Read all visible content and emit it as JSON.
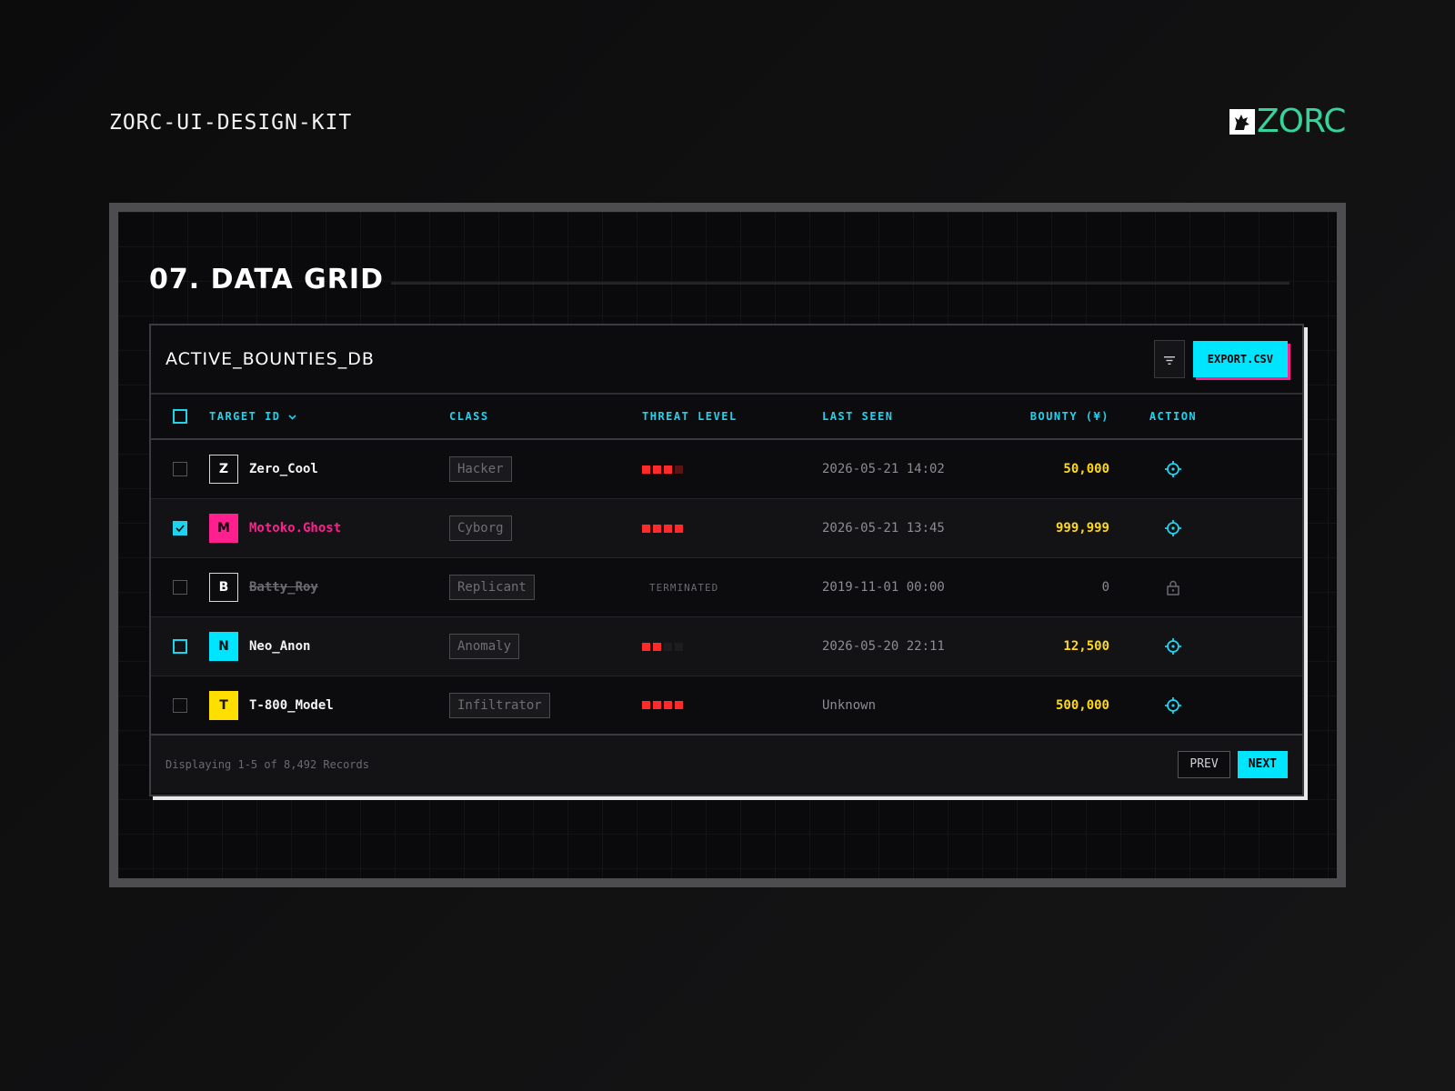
{
  "page": {
    "kit_title": "ZORC-UI-DESIGN-KIT",
    "brand_name": "ZORC",
    "brand_color": "#37d39a"
  },
  "section": {
    "title": "07. DATA GRID"
  },
  "panel": {
    "title": "ACTIVE_BOUNTIES_DB",
    "filter_icon": "filter-icon",
    "export_label": "EXPORT.CSV"
  },
  "columns": {
    "target_id": "TARGET ID",
    "class": "CLASS",
    "threat_level": "THREAT LEVEL",
    "last_seen": "LAST SEEN",
    "bounty": "BOUNTY (¥)",
    "action": "ACTION"
  },
  "rows": [
    {
      "initial": "Z",
      "target": "Zero_Cool",
      "class": "Hacker",
      "threat": 3,
      "threat_text": "",
      "last_seen": "2026-05-21 14:02",
      "bounty": "50,000",
      "action": "crosshair-icon",
      "checked": false
    },
    {
      "initial": "M",
      "target": "Motoko.Ghost",
      "class": "Cyborg",
      "threat": 4,
      "threat_text": "",
      "last_seen": "2026-05-21 13:45",
      "bounty": "999,999",
      "action": "crosshair-icon",
      "checked": true
    },
    {
      "initial": "B",
      "target": "Batty_Roy",
      "class": "Replicant",
      "threat": 0,
      "threat_text": "TERMINATED",
      "last_seen": "2019-11-01 00:00",
      "bounty": "0",
      "action": "lock-icon",
      "checked": false
    },
    {
      "initial": "N",
      "target": "Neo_Anon",
      "class": "Anomaly",
      "threat": 2,
      "threat_text": "",
      "last_seen": "2026-05-20 22:11",
      "bounty": "12,500",
      "action": "crosshair-icon",
      "checked": false
    },
    {
      "initial": "T",
      "target": "T-800_Model",
      "class": "Infiltrator",
      "threat": 4,
      "threat_text": "",
      "last_seen": "Unknown",
      "bounty": "500,000",
      "action": "crosshair-icon",
      "checked": false
    }
  ],
  "footer": {
    "status": "Displaying 1-5 of 8,492 Records",
    "prev_label": "PREV",
    "next_label": "NEXT"
  },
  "colors": {
    "accent_cyan": "#00e5ff",
    "accent_pink": "#ff1f8f",
    "accent_yellow": "#ffdf00",
    "threat_red": "#ff2a2a"
  }
}
